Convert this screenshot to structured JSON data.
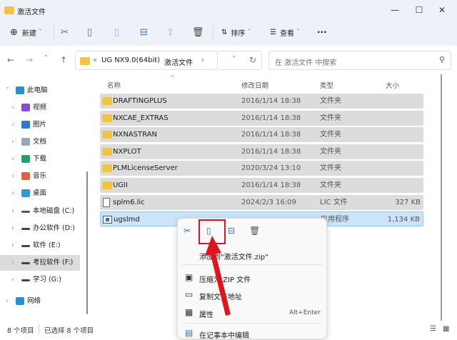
{
  "window": {
    "title": "激活文件",
    "minimize": "—",
    "maximize": "☐",
    "close": "✕"
  },
  "toolbar": {
    "new_label": "新建",
    "sort_label": "排序",
    "view_label": "查看",
    "more": "···"
  },
  "address": {
    "back": "←",
    "forward": "→",
    "recent": "˅",
    "up": "↑",
    "overflow": "«",
    "crumbs": [
      "UG NX9.0(64bit)",
      "激活文件"
    ],
    "sep": "›",
    "dropdown": "˅",
    "refresh": "↻"
  },
  "search": {
    "placeholder": "在 激活文件 中搜索",
    "icon": "⚲"
  },
  "columns": {
    "name": "名称",
    "date": "修改日期",
    "type": "类型",
    "size": "大小"
  },
  "files": [
    {
      "name": "DRAFTINGPLUS",
      "date": "2016/1/14 18:38",
      "type": "文件夹",
      "size": "",
      "icon": "folder"
    },
    {
      "name": "NXCAE_EXTRAS",
      "date": "2016/1/14 18:38",
      "type": "文件夹",
      "size": "",
      "icon": "folder"
    },
    {
      "name": "NXNASTRAN",
      "date": "2016/1/14 18:38",
      "type": "文件夹",
      "size": "",
      "icon": "folder"
    },
    {
      "name": "NXPLOT",
      "date": "2016/1/14 18:38",
      "type": "文件夹",
      "size": "",
      "icon": "folder"
    },
    {
      "name": "PLMLicenseServer",
      "date": "2020/3/24 13:10",
      "type": "文件夹",
      "size": "",
      "icon": "folder"
    },
    {
      "name": "UGII",
      "date": "2016/1/14 18:38",
      "type": "文件夹",
      "size": "",
      "icon": "folder"
    },
    {
      "name": "splm6.lic",
      "date": "2024/2/3 16:09",
      "type": "LIC 文件",
      "size": "327 KB",
      "icon": "file"
    },
    {
      "name": "ugslmd",
      "date": "",
      "type": "应用程序",
      "size": "1,134 KB",
      "icon": "app"
    }
  ],
  "sidebar": [
    {
      "label": "此电脑",
      "color": "#2b8fd6",
      "chev": "˅"
    },
    {
      "label": "视频",
      "color": "#8a4bd6",
      "chev": "›"
    },
    {
      "label": "图片",
      "color": "#2b7bd6",
      "chev": "›"
    },
    {
      "label": "文档",
      "color": "#9aa7b8",
      "chev": "›"
    },
    {
      "label": "下载",
      "color": "#1fa36a",
      "chev": "›"
    },
    {
      "label": "音乐",
      "color": "#e5603a",
      "chev": "›"
    },
    {
      "label": "桌面",
      "color": "#2b9ad6",
      "chev": "›"
    },
    {
      "label": "本地磁盘 (C:)",
      "color": "#555",
      "chev": "›"
    },
    {
      "label": "办公软件 (D:)",
      "color": "#444",
      "chev": "›"
    },
    {
      "label": "软件 (E:)",
      "color": "#444",
      "chev": "›"
    },
    {
      "label": "考拉软件 (F:)",
      "color": "#444",
      "chev": "›"
    },
    {
      "label": "学习 (G:)",
      "color": "#444",
      "chev": "›"
    },
    {
      "label": "网络",
      "color": "#2b8fd6",
      "chev": "›"
    }
  ],
  "context_menu": {
    "add_to_zip": "添加到\"激活文件.zip\"",
    "compress_zip": "压缩为 ZIP 文件",
    "copy_path": "复制文件地址",
    "properties": "属性",
    "properties_shortcut": "Alt+Enter",
    "edit_notepad": "在记事本中编辑"
  },
  "status": {
    "count": "8 个项目",
    "selected": "已选择 8 个项目"
  },
  "colors": {
    "highlight": "#e0141e",
    "accent": "#3a6fb5"
  }
}
